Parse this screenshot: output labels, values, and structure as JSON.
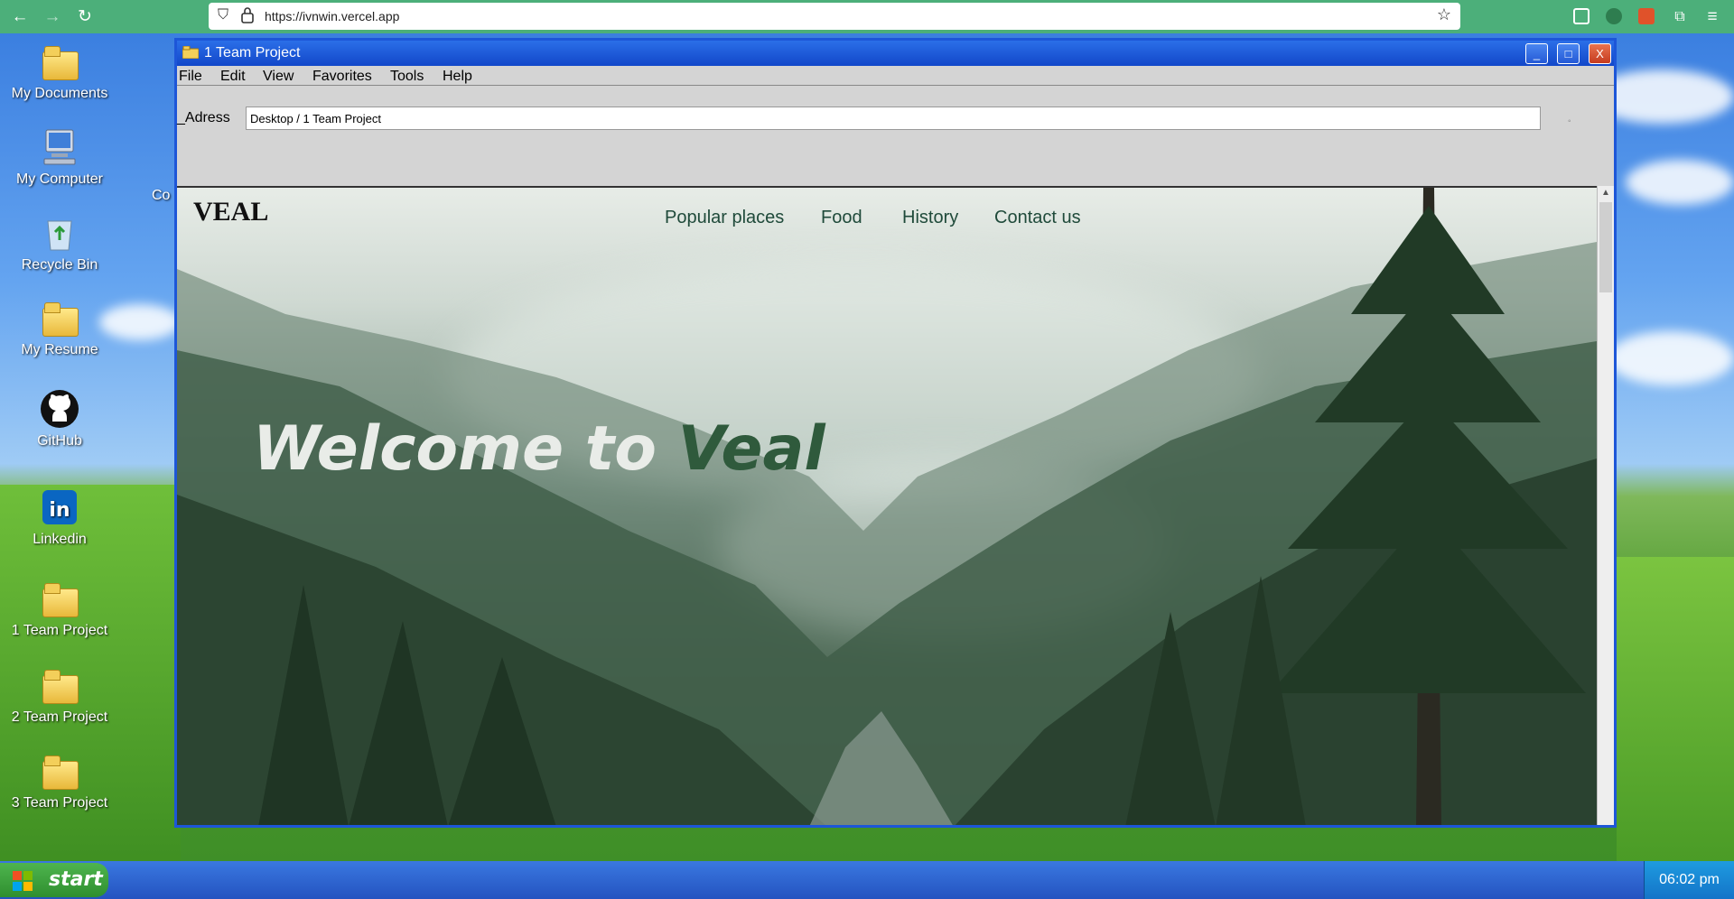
{
  "browser": {
    "url": "https://ivnwin.vercel.app"
  },
  "desktop": {
    "icons": [
      {
        "label": "My Documents"
      },
      {
        "label": "My Computer"
      },
      {
        "label": "Recycle Bin"
      },
      {
        "label": "My Resume"
      },
      {
        "label": "GitHub"
      },
      {
        "label": "Linkedin"
      },
      {
        "label": "1 Team Project"
      },
      {
        "label": "2 Team Project"
      },
      {
        "label": "3 Team Project"
      }
    ],
    "partial_label": "Co"
  },
  "window": {
    "title": "1 Team Project",
    "controls": {
      "minimize": "_",
      "maximize": "□",
      "close": "X"
    },
    "menu": [
      "File",
      "Edit",
      "View",
      "Favorites",
      "Tools",
      "Help"
    ],
    "address_label": "_Adress",
    "address_value": "Desktop / 1 Team Project"
  },
  "site": {
    "logo": "VEAL",
    "nav": [
      "Popular places",
      "Food",
      "History",
      "Contact us"
    ],
    "hero_prefix": "Welcome to ",
    "hero_accent": "Veal"
  },
  "taskbar": {
    "start_label": "start",
    "clock": "06:02 pm"
  },
  "colors": {
    "browser_bar": "#4caf7a",
    "window_border": "#1d56d8",
    "title_bar": "#1247c9",
    "hero_accent": "#2f5a3c",
    "nav_text": "#1f4a3a",
    "taskbar": "#2453c0",
    "start_button": "#2f8f2f"
  }
}
